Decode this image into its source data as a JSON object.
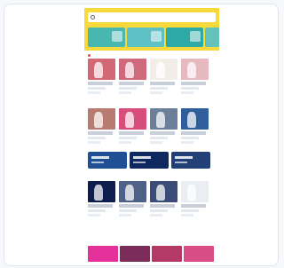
{
  "header": {
    "search_placeholder": "",
    "ticket_label": ""
  },
  "sections": [
    {
      "title": ""
    },
    {
      "title": ""
    },
    {
      "title": ""
    }
  ],
  "colors": {
    "top_yellow": "#f7d93c",
    "accent_red": "#ea4b3b",
    "accent_blue": "#245fb0",
    "accent_green": "#43b65d",
    "accent_pink": "#e84c8a",
    "promo_navy": "#0f2860"
  }
}
